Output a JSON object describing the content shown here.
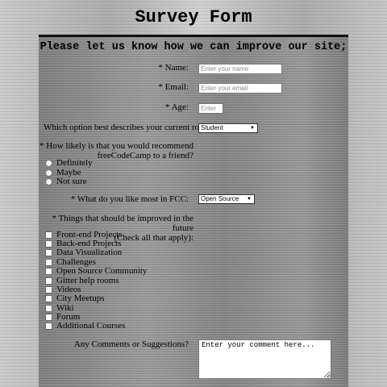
{
  "page": {
    "title": "Survey Form"
  },
  "form": {
    "heading": "Please let us know how we can improve our site;",
    "name": {
      "label": "* Name:",
      "placeholder": "Enter your name",
      "value": ""
    },
    "email": {
      "label": "* Email:",
      "placeholder": "Enter your email",
      "value": ""
    },
    "age": {
      "label": "* Age:",
      "placeholder": "Enter",
      "value": ""
    },
    "role": {
      "label": "Which option best describes your current role?",
      "selected": "Student",
      "icon": "chevron-down-icon"
    },
    "recommend": {
      "label_line1": "* How likely is that you would recommend",
      "label_line2": "freeCodeCamp to a friend?",
      "options": [
        "Definitely",
        "Maybe",
        "Not sure"
      ]
    },
    "like_most": {
      "label": "* What do you like most in FCC:",
      "selected": "Open Source",
      "icon": "chevron-down-icon"
    },
    "improvements": {
      "label_line1": "* Things that should be improved in the future",
      "label_line2": "(Check all that apply):",
      "options": [
        "Front-end Projects",
        "Back-end Projects",
        "Data Visualization",
        "Challenges",
        "Open Source Community",
        "Gitter help rooms",
        "Videos",
        "City Meetups",
        "Wiki",
        "Forum",
        "Additional Courses"
      ]
    },
    "comments": {
      "label": "Any Comments or Suggestions?",
      "placeholder": "Enter your comment here..."
    }
  }
}
